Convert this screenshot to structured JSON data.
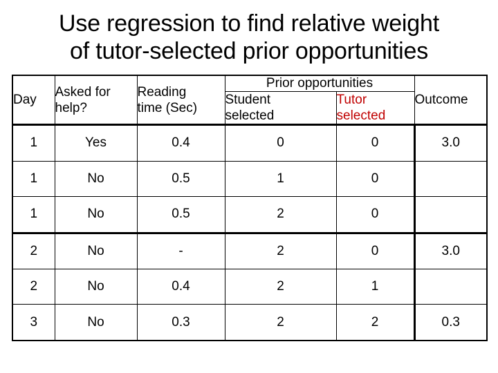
{
  "slide": {
    "title_line_1": "Use regression to find relative weight",
    "title_line_2": "of tutor-selected prior opportunities"
  },
  "colors": {
    "tutor_selected_red": "#C00000",
    "text_black": "#000000",
    "background": "#FFFFFF",
    "border": "#000000"
  },
  "table": {
    "header": {
      "day": "Day",
      "asked_for_help_line1": "Asked for",
      "asked_for_help_line2": "help?",
      "reading_time_line1": "Reading",
      "reading_time_line2": "time (Sec)",
      "prior_opportunities_group": "Prior opportunities",
      "student_selected_line1": "Student",
      "student_selected_line2": "selected",
      "tutor_selected_line1": "Tutor",
      "tutor_selected_line2": "selected",
      "outcome": "Outcome"
    },
    "rows": [
      {
        "day": "1",
        "asked_for_help": "Yes",
        "reading_time": "0.4",
        "student_selected": "0",
        "tutor_selected": "0",
        "outcome": "3.0"
      },
      {
        "day": "1",
        "asked_for_help": "No",
        "reading_time": "0.5",
        "student_selected": "1",
        "tutor_selected": "0",
        "outcome": ""
      },
      {
        "day": "1",
        "asked_for_help": "No",
        "reading_time": "0.5",
        "student_selected": "2",
        "tutor_selected": "0",
        "outcome": ""
      },
      {
        "day": "2",
        "asked_for_help": "No",
        "reading_time": "-",
        "student_selected": "2",
        "tutor_selected": "0",
        "outcome": "3.0"
      },
      {
        "day": "2",
        "asked_for_help": "No",
        "reading_time": "0.4",
        "student_selected": "2",
        "tutor_selected": "1",
        "outcome": ""
      },
      {
        "day": "3",
        "asked_for_help": "No",
        "reading_time": "0.3",
        "student_selected": "2",
        "tutor_selected": "2",
        "outcome": "0.3"
      }
    ]
  }
}
